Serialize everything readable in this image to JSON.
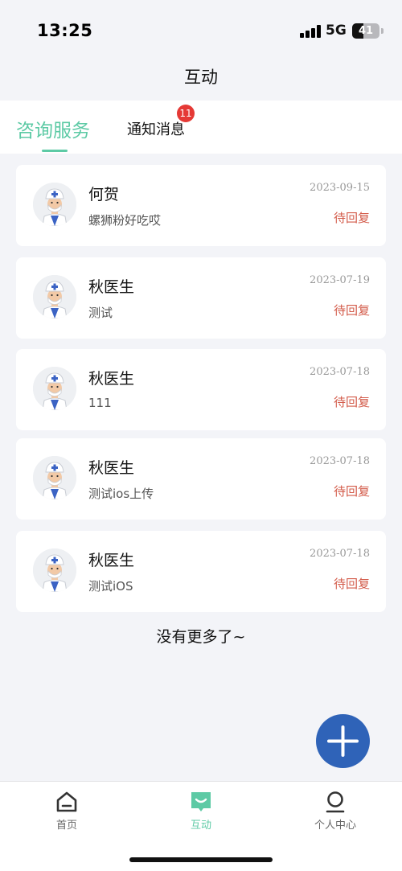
{
  "status_bar": {
    "time": "13:25",
    "network": "5G",
    "battery": "41",
    "battery_level": 0.41
  },
  "nav": {
    "title": "互动"
  },
  "tabs": {
    "consult_label": "咨询服务",
    "notice_label": "通知消息",
    "notice_badge": "11"
  },
  "consultations": [
    {
      "name": "何贺",
      "message": "螺狮粉好吃哎",
      "date": "2023-09-15",
      "status": "待回复"
    },
    {
      "name": "秋医生",
      "message": "测试",
      "date": "2023-07-19",
      "status": "待回复"
    },
    {
      "name": "秋医生",
      "message": "111",
      "date": "2023-07-18",
      "status": "待回复"
    },
    {
      "name": "秋医生",
      "message": "测试ios上传",
      "date": "2023-07-18",
      "status": "待回复"
    },
    {
      "name": "秋医生",
      "message": "测试iOS",
      "date": "2023-07-18",
      "status": "待回复"
    }
  ],
  "footer_text": "没有更多了~",
  "fab": {
    "icon": "plus-icon"
  },
  "tabbar": {
    "items": [
      {
        "label": "首页",
        "icon": "home-icon"
      },
      {
        "label": "互动",
        "icon": "chat-icon"
      },
      {
        "label": "个人中心",
        "icon": "person-icon"
      }
    ]
  },
  "colors": {
    "accent": "#5dcaa5",
    "pending": "#d35b4a",
    "fab": "#2f63b8",
    "badge": "#e53935"
  }
}
